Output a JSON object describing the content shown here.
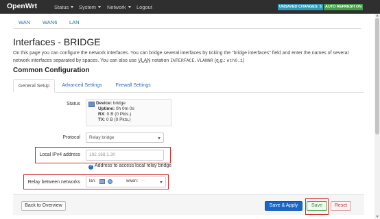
{
  "navbar": {
    "brand": "OpenWrt",
    "menu": [
      "Status",
      "System",
      "Network",
      "Logout"
    ],
    "badges": [
      {
        "label": "UNSAVED CHANGES: 5",
        "color": "#2e98b6"
      },
      {
        "label": "AUTO REFRESH ON",
        "color": "#43a047"
      }
    ]
  },
  "subnav": [
    "WAN",
    "WAN6",
    "LAN"
  ],
  "page": {
    "title": "Interfaces - BRIDGE",
    "desc_1": "On this page you can configure the network interfaces. You can bridge several interfaces by ticking the \"bridge interfaces\" field and enter the names of several",
    "desc_2a": "network interfaces separated by spaces. You can also use ",
    "desc_vlan": "VLAN",
    "desc_2b": " notation ",
    "desc_code1": "INTERFACE.VLANNR",
    "desc_2c": " (",
    "desc_eg": "e.g.",
    "desc_2d": ": ",
    "desc_code2": "eth0.1",
    "desc_2e": ")",
    "section": "Common Configuration"
  },
  "tabs": [
    "General Setup",
    "Advanced Settings",
    "Firewall Settings"
  ],
  "status": {
    "label": "Status",
    "device_key": "Device:",
    "device_val": "bridge",
    "uptime_key": "Uptime:",
    "uptime_val": "0h 0m 0s",
    "rx_key": "RX",
    "rx_val": ": 0 B (0 Pkts.)",
    "tx_key": "TX",
    "tx_val": ": 0 B (0 Pkts.)"
  },
  "protocol": {
    "label": "Protocol",
    "value": "Relay bridge"
  },
  "local_ip": {
    "label": "Local IPv4 address",
    "placeholder": "192.168.1.30",
    "help": "Address to access local relay bridge"
  },
  "relay": {
    "label": "Relay between networks",
    "chips": [
      "lan:",
      "wwan:"
    ]
  },
  "footer": {
    "back": "Back to Overview",
    "save_apply": "Save & Apply",
    "save": "Save",
    "reset": "Reset"
  },
  "colors": {
    "link": "#2a6ab3",
    "highlight": "#d12a2a",
    "navbar": "#2f2f2f"
  }
}
